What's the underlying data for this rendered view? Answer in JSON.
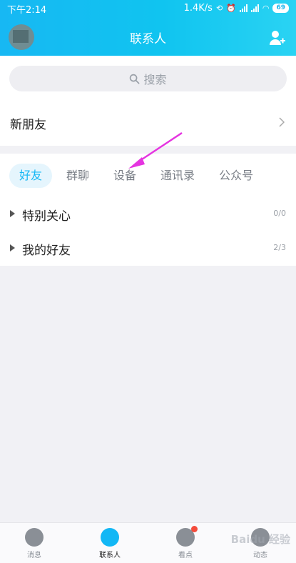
{
  "status_bar": {
    "time": "下午2:14",
    "net_speed": "1.4K/s",
    "battery": "69"
  },
  "header": {
    "title": "联系人"
  },
  "search": {
    "placeholder": "搜索"
  },
  "new_friends": {
    "label": "新朋友"
  },
  "tabs": [
    {
      "label": "好友",
      "active": true
    },
    {
      "label": "群聊",
      "active": false
    },
    {
      "label": "设备",
      "active": false
    },
    {
      "label": "通讯录",
      "active": false
    },
    {
      "label": "公众号",
      "active": false
    }
  ],
  "groups": [
    {
      "name": "特别关心",
      "count": "0/0"
    },
    {
      "name": "我的好友",
      "count": "2/3"
    }
  ],
  "bottom_nav": [
    {
      "label": "消息",
      "active": false
    },
    {
      "label": "联系人",
      "active": true
    },
    {
      "label": "看点",
      "active": false
    },
    {
      "label": "动态",
      "active": false
    }
  ],
  "colors": {
    "accent": "#12b7f5",
    "annotation_arrow": "#e534e0",
    "badge": "#f44b3b"
  },
  "watermark": "Baidu 经验"
}
